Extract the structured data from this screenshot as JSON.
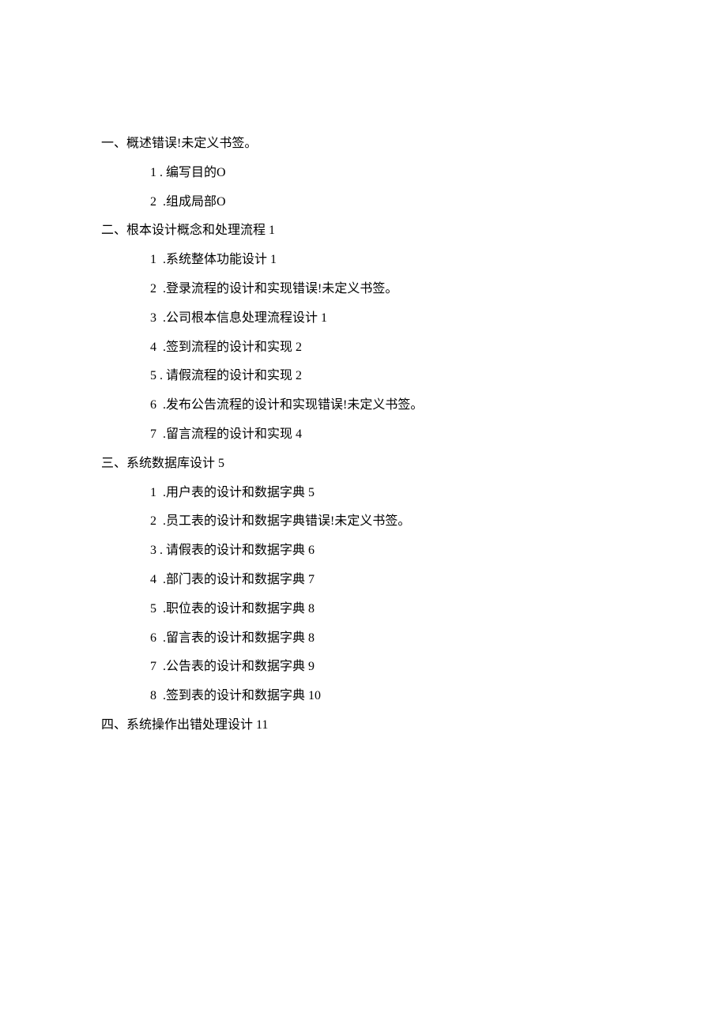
{
  "toc": [
    {
      "level": 1,
      "text": "一、概述错误!未定义书签。"
    },
    {
      "level": 2,
      "text": "1 . 编写目的O"
    },
    {
      "level": 2,
      "text": "2  .组成局部O"
    },
    {
      "level": 1,
      "text": "二、根本设计概念和处理流程 1"
    },
    {
      "level": 2,
      "text": "1  .系统整体功能设计 1"
    },
    {
      "level": 2,
      "text": "2  .登录流程的设计和实现错误!未定义书签。"
    },
    {
      "level": 2,
      "text": "3  .公司根本信息处理流程设计 1"
    },
    {
      "level": 2,
      "text": "4  .签到流程的设计和实现 2"
    },
    {
      "level": 2,
      "text": "5 . 请假流程的设计和实现 2"
    },
    {
      "level": 2,
      "text": "6  .发布公告流程的设计和实现错误!未定义书签。"
    },
    {
      "level": 2,
      "text": "7  .留言流程的设计和实现 4"
    },
    {
      "level": 1,
      "text": "三、系统数据库设计 5"
    },
    {
      "level": 2,
      "text": "1  .用户表的设计和数据字典 5"
    },
    {
      "level": 2,
      "text": "2  .员工表的设计和数据字典错误!未定义书签。"
    },
    {
      "level": 2,
      "text": "3 . 请假表的设计和数据字典 6"
    },
    {
      "level": 2,
      "text": "4  .部门表的设计和数据字典 7"
    },
    {
      "level": 2,
      "text": "5  .职位表的设计和数据字典 8"
    },
    {
      "level": 2,
      "text": "6  .留言表的设计和数据字典 8"
    },
    {
      "level": 2,
      "text": "7  .公告表的设计和数据字典 9"
    },
    {
      "level": 2,
      "text": "8  .签到表的设计和数据字典 10"
    },
    {
      "level": 1,
      "text": "四、系统操作出错处理设计 11"
    }
  ]
}
